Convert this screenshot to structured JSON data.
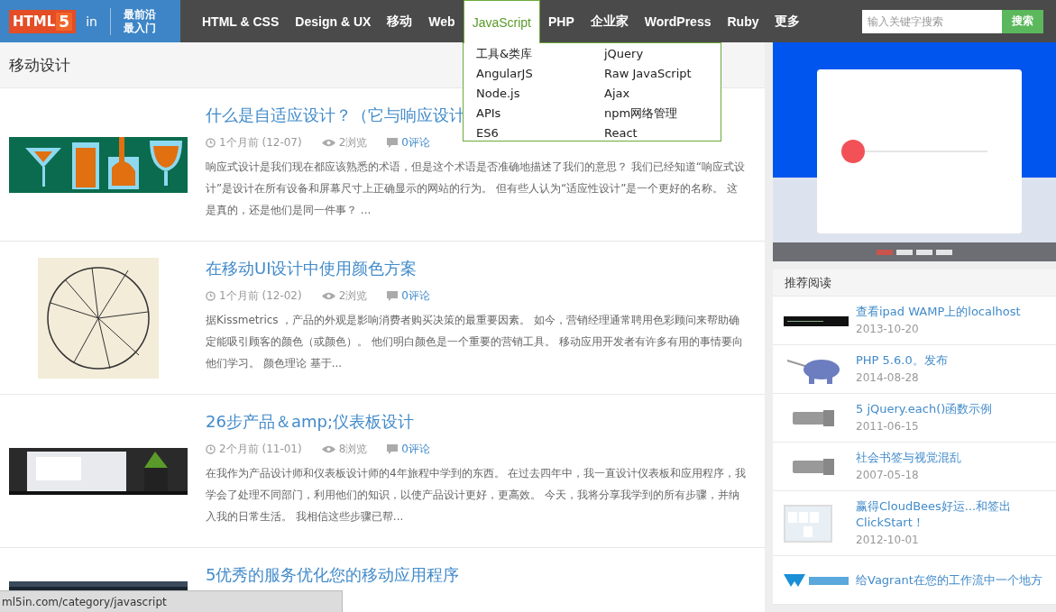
{
  "logo": {
    "mark": "HTML",
    "digit": "5",
    "suffix": "in",
    "tagline": [
      "最前沿",
      "最入门"
    ]
  },
  "nav": [
    {
      "label": "HTML & CSS",
      "selected": false
    },
    {
      "label": "Design & UX",
      "selected": false
    },
    {
      "label": "移动",
      "selected": false
    },
    {
      "label": "Web",
      "selected": false
    },
    {
      "label": "JavaScript",
      "selected": true
    },
    {
      "label": "PHP",
      "selected": false
    },
    {
      "label": "企业家",
      "selected": false
    },
    {
      "label": "WordPress",
      "selected": false
    },
    {
      "label": "Ruby",
      "selected": false
    },
    {
      "label": "更多",
      "selected": false
    }
  ],
  "dropdown": [
    "工具&类库",
    "jQuery",
    "AngularJS",
    "Raw JavaScript",
    "Node.js",
    "Ajax",
    "APIs",
    "npm网络管理",
    "ES6",
    "React"
  ],
  "search": {
    "placeholder": "输入关键字搜索",
    "button": "搜索"
  },
  "category_title": "移动设计",
  "posts": [
    {
      "title": "什么是自适应设计？（它与响应设计",
      "time": "1个月前 (12-07)",
      "views": "2浏览",
      "comments": "0评论",
      "excerpt": "响应式设计是我们现在都应该熟悉的术语，但是这个术语是否准确地描述了我们的意思？ 我们已经知道“响应式设计”是设计在所有设备和屏幕尺寸上正确显示的网站的行为。 但有些人认为“适应性设计”是一个更好的名称。 这是真的，还是他们是同一件事？ ..."
    },
    {
      "title": "在移动UI设计中使用颜色方案",
      "time": "1个月前 (12-02)",
      "views": "2浏览",
      "comments": "0评论",
      "excerpt": "据Kissmetrics ，产品的外观是影响消费者购买决策的最重要因素。 如今，营销经理通常聘用色彩顾问来帮助确定能吸引顾客的颜色（或颜色）。 他们明白颜色是一个重要的营销工具。 移动应用开发者有许多有用的事情要向他们学习。 颜色理论 基于..."
    },
    {
      "title": "26步产品＆amp;仪表板设计",
      "time": "2个月前 (11-01)",
      "views": "8浏览",
      "comments": "0评论",
      "excerpt": "在我作为产品设计师和仪表板设计师的4年旅程中学到的东西。 在过去四年中，我一直设计仪表板和应用程序，我学会了处理不同部门，利用他们的知识，以使产品设计更好，更高效。 今天，我将分享我学到的所有步骤，并纳入我的日常生活。 我相信这些步骤已帮..."
    },
    {
      "title": "5优秀的服务优化您的移动应用程序"
    }
  ],
  "carousel": [
    {
      "selected": true
    },
    {
      "selected": false
    },
    {
      "selected": false
    },
    {
      "selected": false
    }
  ],
  "sidebar": {
    "title": "推荐阅读",
    "items": [
      {
        "title": "查看ipad WAMP上的localhost",
        "date": "2013-10-20"
      },
      {
        "title": "PHP 5.6.0。发布",
        "date": "2014-08-28"
      },
      {
        "title": "5 jQuery.each()函数示例",
        "date": "2011-06-15"
      },
      {
        "title": "社会书签与视觉混乱",
        "date": "2007-05-18"
      },
      {
        "title": "赢得CloudBees好运...和签出ClickStart！",
        "date": "2012-10-01"
      },
      {
        "title": "给Vagrant在您的工作流中一个地方"
      }
    ]
  },
  "status_bar": "ml5in.com/category/javascript"
}
